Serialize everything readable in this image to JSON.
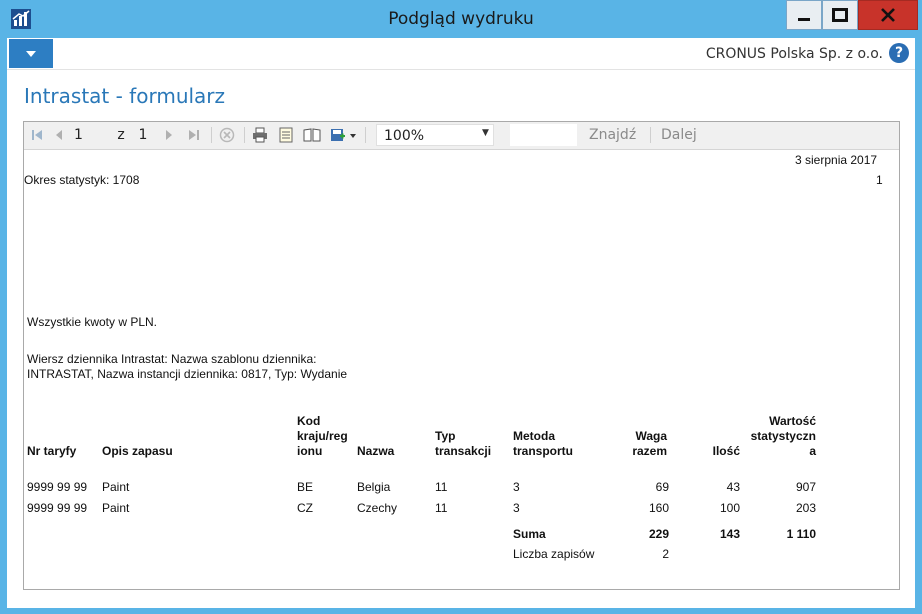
{
  "window": {
    "title": "Podgląd wydruku"
  },
  "header": {
    "company": "CRONUS Polska Sp. z o.o.",
    "page_title": "Intrastat - formularz"
  },
  "toolbar": {
    "page_current": "1",
    "page_of_label": "z",
    "page_total": "1",
    "zoom": "100%",
    "find_label": "Znajdź",
    "next_label": "Dalej"
  },
  "report": {
    "date": "3 sierpnia 2017",
    "page_number": "1",
    "period": "Okres statystyk: 1708",
    "currency_note": "Wszystkie kwoty w PLN.",
    "filter_line1": "Wiersz dziennika Intrastat: Nazwa szablonu dziennika:",
    "filter_line2": "INTRASTAT, Nazwa instancji dziennika: 0817, Typ: Wydanie",
    "columns": {
      "tariff_no": "Nr taryfy",
      "item_desc": "Opis zapasu",
      "country_code": [
        "Kod",
        "kraju/reg",
        "ionu"
      ],
      "name": "Nazwa",
      "transaction_type": [
        "Typ",
        "transakcji"
      ],
      "transport_method": [
        "Metoda",
        "transportu"
      ],
      "total_weight": [
        "Waga",
        "razem"
      ],
      "quantity": "Ilość",
      "statistical_value": [
        "Wartość",
        "statystyczn",
        "a"
      ]
    },
    "rows": [
      {
        "tariff_no": "9999 99 99",
        "item_desc": "Paint",
        "country_code": "BE",
        "name": "Belgia",
        "transaction_type": "11",
        "transport_method": "3",
        "total_weight": "69",
        "quantity": "43",
        "statistical_value": "907"
      },
      {
        "tariff_no": "9999 99 99",
        "item_desc": "Paint",
        "country_code": "CZ",
        "name": "Czechy",
        "transaction_type": "11",
        "transport_method": "3",
        "total_weight": "160",
        "quantity": "100",
        "statistical_value": "203"
      }
    ],
    "totals": {
      "label": "Suma",
      "total_weight": "229",
      "quantity": "143",
      "statistical_value": "1 110"
    },
    "record_count": {
      "label": "Liczba zapisów",
      "value": "2"
    }
  },
  "colors": {
    "window_frame": "#59b4e6",
    "title_blue": "#2a78b8",
    "menu_button": "#2d7ec3",
    "close_button": "#c8332a"
  }
}
